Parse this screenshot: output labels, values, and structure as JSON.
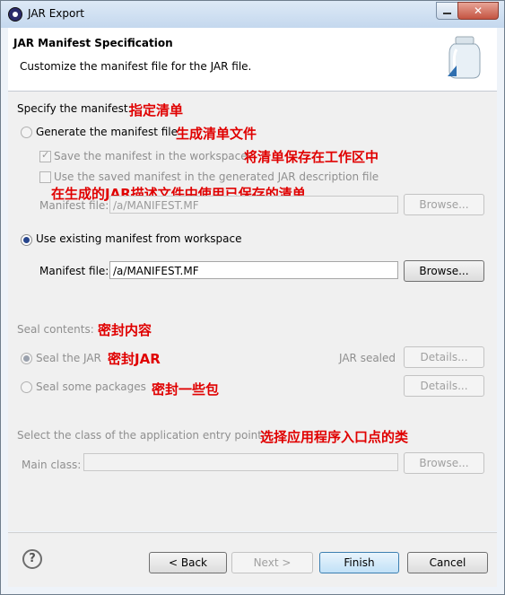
{
  "window": {
    "title": "JAR Export"
  },
  "header": {
    "title": "JAR Manifest Specification",
    "description": "Customize the manifest file for the JAR file."
  },
  "manifest": {
    "label": "Specify the manifest:",
    "label_cn": "指定清单",
    "generate_label": "Generate the manifest file",
    "generate_cn": "生成清单文件",
    "save_label": "Save the manifest in the workspace",
    "save_cn": "将清单保存在工作区中",
    "reuse_label": "Use the saved manifest in the generated JAR description file",
    "reuse_cn": "在生成的JAR描述文件中使用已保存的清单",
    "gen_file_label": "Manifest file:",
    "gen_file_value": "/a/MANIFEST.MF",
    "gen_browse": "Browse...",
    "existing_label": "Use existing manifest from workspace",
    "file_label": "Manifest file:",
    "file_value": "/a/MANIFEST.MF",
    "browse": "Browse..."
  },
  "seal": {
    "label": "Seal contents:",
    "label_cn": "密封内容",
    "seal_jar": "Seal the JAR",
    "seal_jar_cn": "密封JAR",
    "status": "JAR sealed",
    "details": "Details...",
    "seal_some": "Seal some packages",
    "seal_some_cn": "密封一些包",
    "details2": "Details..."
  },
  "entry": {
    "label": "Select the class of the application entry point:",
    "label_cn": "选择应用程序入口点的类",
    "main_label": "Main class:",
    "main_value": "",
    "browse": "Browse..."
  },
  "footer": {
    "help": "?",
    "back": "< Back",
    "next": "Next >",
    "finish": "Finish",
    "cancel": "Cancel"
  }
}
